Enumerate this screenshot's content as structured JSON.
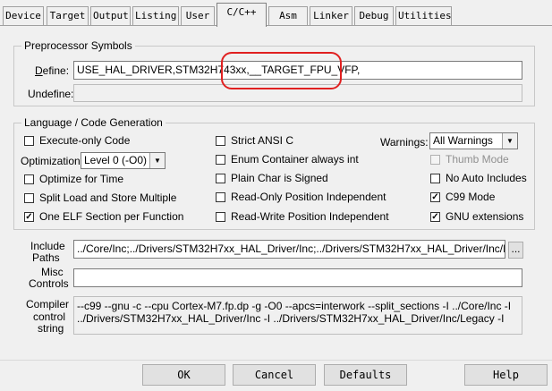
{
  "tabs": [
    {
      "label": "Device",
      "active": false
    },
    {
      "label": "Target",
      "active": false
    },
    {
      "label": "Output",
      "active": false
    },
    {
      "label": "Listing",
      "active": false
    },
    {
      "label": "User",
      "active": false
    },
    {
      "label": "C/C++",
      "active": true
    },
    {
      "label": "Asm",
      "active": false
    },
    {
      "label": "Linker",
      "active": false
    },
    {
      "label": "Debug",
      "active": false
    },
    {
      "label": "Utilities",
      "active": false
    }
  ],
  "preprocessor": {
    "title": "Preprocessor Symbols",
    "define_label": "Define:",
    "define_value": "USE_HAL_DRIVER,STM32H743xx,__TARGET_FPU_VFP,",
    "undefine_label": "Undefine:",
    "undefine_value": ""
  },
  "language": {
    "title": "Language / Code Generation",
    "execute_only": "Execute-only Code",
    "optimization_label": "Optimization:",
    "optimization_value": "Level 0 (-O0)",
    "optimize_time": "Optimize for Time",
    "split_load": "Split Load and Store Multiple",
    "one_elf": "One ELF Section per Function",
    "strict_ansi": "Strict ANSI C",
    "enum_container": "Enum Container always int",
    "plain_char": "Plain Char is Signed",
    "ro_position": "Read-Only Position Independent",
    "rw_position": "Read-Write Position Independent",
    "warnings_label": "Warnings:",
    "warnings_value": "All Warnings",
    "thumb_mode": "Thumb Mode",
    "no_auto_includes": "No Auto Includes",
    "c99_mode": "C99 Mode",
    "gnu_extensions": "GNU extensions"
  },
  "include": {
    "label_line1": "Include",
    "label_line2": "Paths",
    "value": "../Core/Inc;../Drivers/STM32H7xx_HAL_Driver/Inc;../Drivers/STM32H7xx_HAL_Driver/Inc/Legacy",
    "browse_label": "..."
  },
  "misc": {
    "label_line1": "Misc",
    "label_line2": "Controls",
    "value": ""
  },
  "compiler": {
    "label_line1": "Compiler",
    "label_line2": "control",
    "label_line3": "string",
    "value": "--c99 --gnu -c --cpu Cortex-M7.fp.dp -g -O0 --apcs=interwork --split_sections -I ../Core/Inc -I\n../Drivers/STM32H7xx_HAL_Driver/Inc -I ../Drivers/STM32H7xx_HAL_Driver/Inc/Legacy -I"
  },
  "buttons": {
    "ok": "OK",
    "cancel": "Cancel",
    "defaults": "Defaults",
    "help": "Help"
  },
  "colors": {
    "highlight": "#e02020"
  }
}
